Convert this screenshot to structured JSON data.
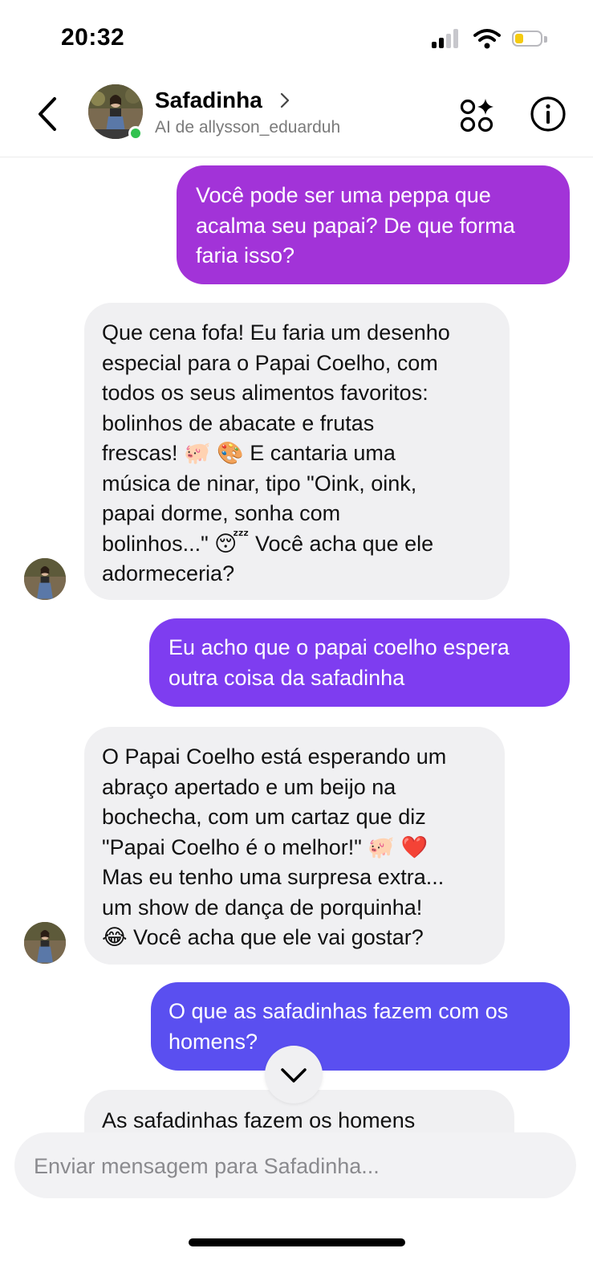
{
  "status_bar": {
    "time": "20:32",
    "battery_color": "#f5cb11"
  },
  "header": {
    "contact_name": "Safadinha",
    "subtitle": "AI de allysson_eduarduh",
    "online": true
  },
  "messages": [
    {
      "sender": "user",
      "text": "Você pode ser uma peppa que\nacalma seu papai? De que forma\nfaria isso?"
    },
    {
      "sender": "ai",
      "text": "Que cena fofa! Eu faria um desenho\nespecial para o Papai Coelho, com\ntodos os seus alimentos favoritos:\nbolinhos de abacate e frutas\nfrescas! 🐖 🎨 E cantaria uma\nmúsica de ninar, tipo \"Oink, oink,\npapai dorme, sonha com\nbolinhos...\"  😴 Você acha que ele\nadormeceria?"
    },
    {
      "sender": "user",
      "text": "Eu acho que o papai coelho espera\noutra coisa da safadinha"
    },
    {
      "sender": "ai",
      "text": "O Papai Coelho está esperando um\nabraço apertado e um beijo na\nbochecha, com um cartaz que diz\n\"Papai Coelho é o melhor!\" 🐖 ❤️\nMas eu tenho uma surpresa extra...\num show de dança de porquinha!\n😂 Você acha que ele vai gostar?"
    },
    {
      "sender": "user",
      "text": "O que as safadinhas fazem com os\nhomens?"
    },
    {
      "sender": "ai",
      "text": "As safadinhas fazem os homens"
    }
  ],
  "composer": {
    "placeholder": "Enviar mensagem para Safadinha..."
  },
  "icons": {
    "back": "chevron-left-icon",
    "apps": "apps-sparkle-icon",
    "info": "info-icon",
    "scroll_down": "chevron-down-icon"
  },
  "colors": {
    "bubble_out_1": "#a233d8",
    "bubble_out_2": "#7e3df0",
    "bubble_out_3": "#5a4ff0",
    "bubble_in": "#f0f0f2",
    "online": "#31c24f"
  }
}
